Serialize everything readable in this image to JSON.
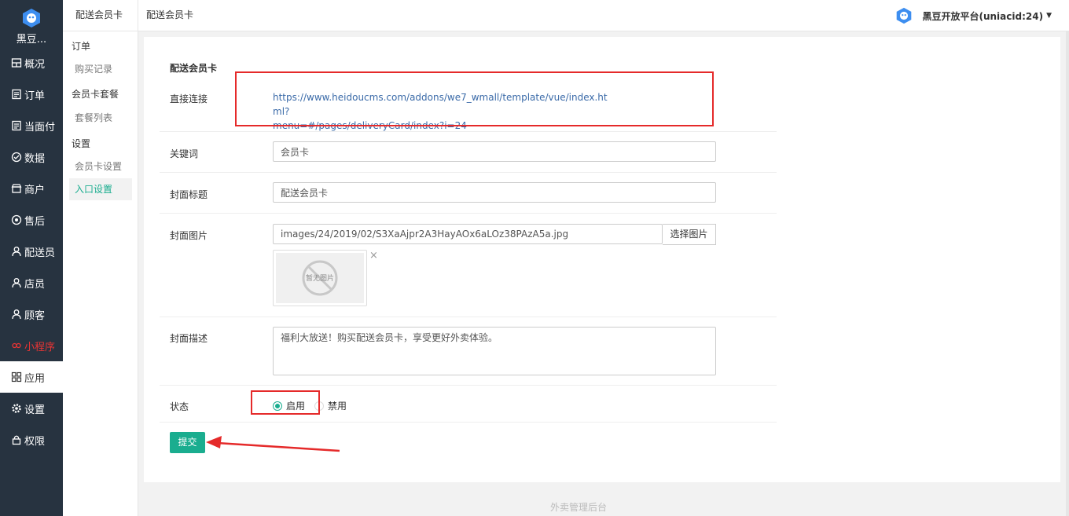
{
  "app": {
    "logo_text": "黑豆...",
    "account_label": "黑豆开放平台(uniacid:24)"
  },
  "leftnav": [
    {
      "label": "概况",
      "icon": "dashboard-icon"
    },
    {
      "label": "订单",
      "icon": "list-icon"
    },
    {
      "label": "当面付",
      "icon": "list-icon"
    },
    {
      "label": "数据",
      "icon": "check-circle-icon"
    },
    {
      "label": "商户",
      "icon": "store-icon"
    },
    {
      "label": "售后",
      "icon": "support-icon"
    },
    {
      "label": "配送员",
      "icon": "user-icon"
    },
    {
      "label": "店员",
      "icon": "user-icon"
    },
    {
      "label": "顾客",
      "icon": "user-icon"
    },
    {
      "label": "小程序",
      "icon": "mini-program-icon"
    },
    {
      "label": "应用",
      "icon": "apps-icon"
    },
    {
      "label": "设置",
      "icon": "gear-icon"
    },
    {
      "label": "权限",
      "icon": "lock-icon"
    }
  ],
  "subnav": {
    "title": "配送会员卡",
    "groups": [
      {
        "label": "订单",
        "items": [
          "购买记录"
        ]
      },
      {
        "label": "会员卡套餐",
        "items": [
          "套餐列表"
        ]
      },
      {
        "label": "设置",
        "items": [
          "会员卡设置",
          "入口设置"
        ]
      }
    ]
  },
  "topbar": {
    "title": "配送会员卡"
  },
  "form": {
    "title": "配送会员卡",
    "link": {
      "label": "直接连接",
      "url_line1": "https://www.heidoucms.com/addons/we7_wmall/template/vue/index.html?",
      "url_line2": "menu=#/pages/deliveryCard/index?i=24"
    },
    "keyword": {
      "label": "关键词",
      "value": "会员卡"
    },
    "cover_title": {
      "label": "封面标题",
      "value": "配送会员卡"
    },
    "cover_image": {
      "label": "封面图片",
      "value": "images/24/2019/02/S3XaAjpr2A3HayAOx6aLOz38PAzA5a.jpg",
      "button": "选择图片",
      "placeholder_text": "暂无图片",
      "close": "×"
    },
    "cover_desc": {
      "label": "封面描述",
      "value": "福利大放送！购买配送会员卡，享受更好外卖体验。"
    },
    "status": {
      "label": "状态",
      "options": [
        "启用",
        "禁用"
      ],
      "selected": "启用"
    },
    "submit": "提交"
  },
  "footer": "外卖管理后台",
  "colors": {
    "accent": "#1aad8f",
    "nav_bg": "#273340",
    "annotation": "#e52a2a"
  }
}
